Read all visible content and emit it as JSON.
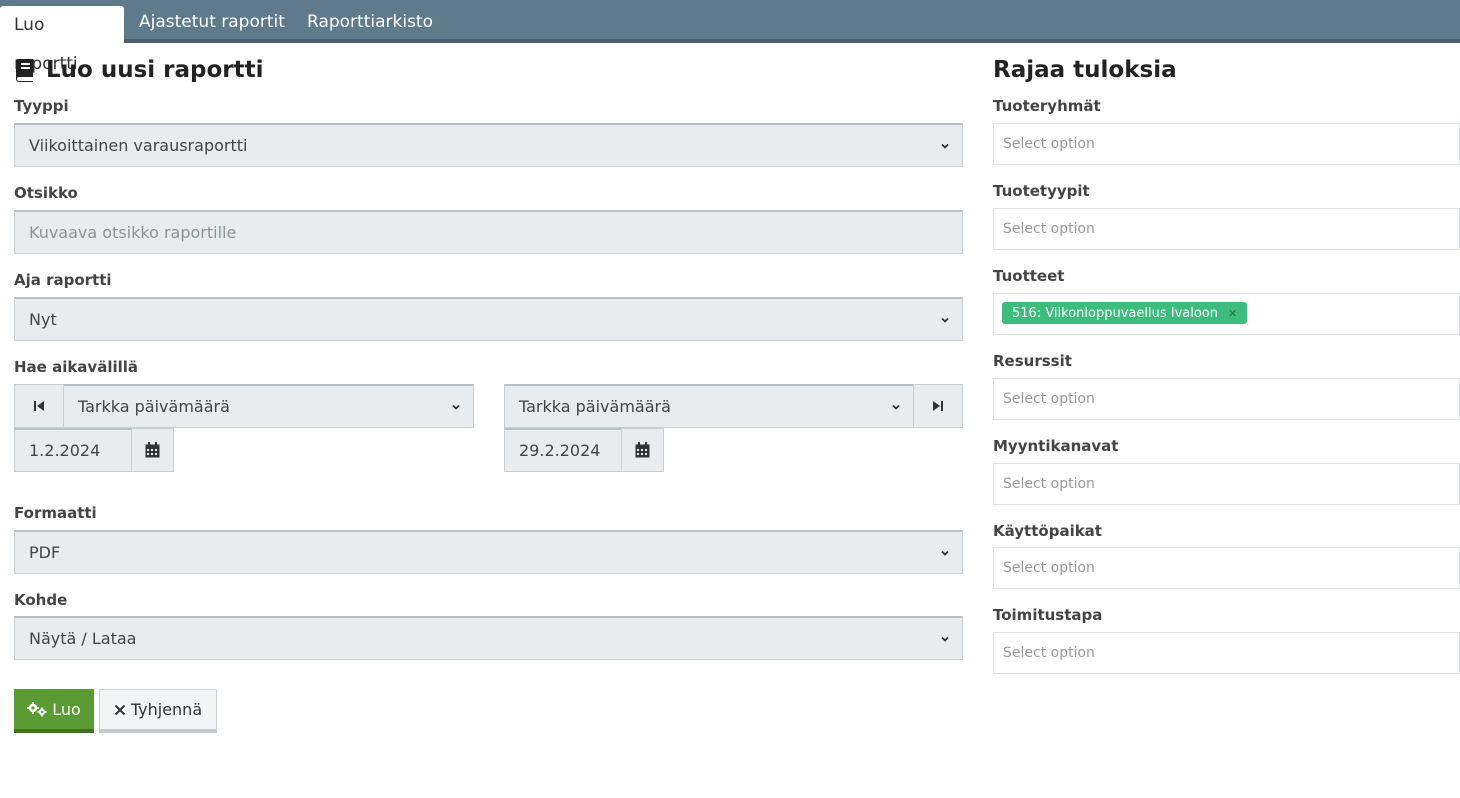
{
  "tabs": [
    {
      "label": "Luo raportti",
      "active": true
    },
    {
      "label": "Ajastetut raportit",
      "active": false
    },
    {
      "label": "Raporttiarkisto",
      "active": false
    }
  ],
  "form": {
    "title": "Luo uusi raportti",
    "type": {
      "label": "Tyyppi",
      "value": "Viikoittainen varausraportti"
    },
    "heading": {
      "label": "Otsikko",
      "placeholder": "Kuvaava otsikko raportille"
    },
    "run": {
      "label": "Aja raportti",
      "value": "Nyt"
    },
    "range": {
      "label": "Hae aikavälillä",
      "start_mode": "Tarkka päivämäärä",
      "end_mode": "Tarkka päivämäärä",
      "start_date": "1.2.2024",
      "end_date": "29.2.2024"
    },
    "format": {
      "label": "Formaatti",
      "value": "PDF"
    },
    "target": {
      "label": "Kohde",
      "value": "Näytä / Lataa"
    },
    "create_label": "Luo",
    "clear_label": "Tyhjennä"
  },
  "filters": {
    "title": "Rajaa tuloksia",
    "placeholder": "Select option",
    "product_groups": "Tuoteryhmät",
    "product_types": "Tuotetyypit",
    "products": "Tuotteet",
    "product_tag": "516: Viikonloppuvaellus Ivaloon",
    "resources": "Resurssit",
    "channels": "Myyntikanavat",
    "locations": "Käyttöpaikat",
    "delivery": "Toimitustapa"
  },
  "colors": {
    "tabbar": "#5f7a8a",
    "primary": "#5b9b34",
    "tag": "#3dbd7d"
  }
}
